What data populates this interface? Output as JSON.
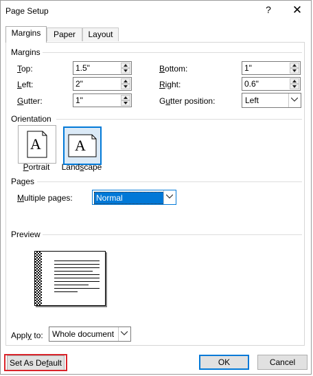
{
  "window": {
    "title": "Page Setup",
    "help_symbol": "?",
    "close_symbol": "✕"
  },
  "tabs": [
    {
      "label": "Margins",
      "active": true
    },
    {
      "label": "Paper",
      "active": false
    },
    {
      "label": "Layout",
      "active": false
    }
  ],
  "margins": {
    "heading": "Margins",
    "top": {
      "mnemonic": "T",
      "rest": "op:",
      "value": "1.5\""
    },
    "left": {
      "mnemonic": "L",
      "rest": "eft:",
      "value": "2\""
    },
    "gutter": {
      "mnemonic": "G",
      "rest": "utter:",
      "value": "1\""
    },
    "bottom": {
      "mnemonic": "B",
      "rest": "ottom:",
      "value": "1\""
    },
    "right": {
      "mnemonic": "R",
      "rest": "ight:",
      "value": "0.6\""
    },
    "gutter_position": {
      "prefix": "G",
      "mnemonic": "u",
      "rest": "tter position:",
      "value": "Left"
    }
  },
  "orientation": {
    "heading": "Orientation",
    "portrait": {
      "mnemonic": "P",
      "rest": "ortrait",
      "glyph": "A",
      "selected": false
    },
    "landscape": {
      "prefix": "Land",
      "mnemonic": "s",
      "rest": "cape",
      "glyph": "A",
      "selected": true
    }
  },
  "pages": {
    "heading": "Pages",
    "multiple_pages": {
      "mnemonic": "M",
      "rest": "ultiple pages:",
      "value": "Normal"
    }
  },
  "preview": {
    "heading": "Preview"
  },
  "apply_to": {
    "prefix": "Appl",
    "mnemonic": "y",
    "rest": " to:",
    "value": "Whole document"
  },
  "buttons": {
    "set_default": {
      "prefix": "Set As De",
      "mnemonic": "f",
      "rest": "ault"
    },
    "ok": "OK",
    "cancel": "Cancel"
  },
  "colors": {
    "accent": "#0078d7",
    "highlight_frame": "#d9232a"
  }
}
